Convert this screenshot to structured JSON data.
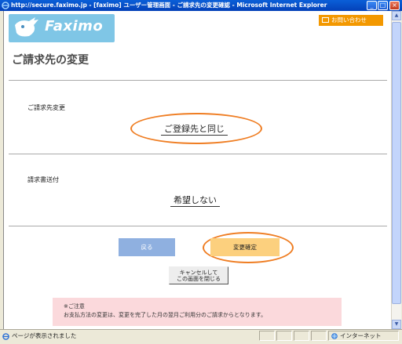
{
  "window": {
    "title": "http://secure.faximo.jp - [faximo] ユーザー管理画面 - ご請求先の変更確認 - Microsoft Internet Explorer",
    "minimize": "_",
    "maximize": "□",
    "close": "×"
  },
  "header": {
    "logo_text": "Faximo",
    "contact_label": "お問い合わせ",
    "contact_color": "#f39800"
  },
  "page": {
    "title": "ご請求先の変更"
  },
  "billing": {
    "label": "ご請求先変更",
    "value": "ご登録先と同じ"
  },
  "invoice": {
    "label": "請求書送付",
    "value": "希望しない"
  },
  "buttons": {
    "back": "戻る",
    "confirm": "変更確定",
    "cancel_line1": "キャンセルして",
    "cancel_line2": "この画面を閉じる"
  },
  "notice": {
    "heading": "※ご注意",
    "text": "お支払方法の変更は、変更を完了した月の翌月ご利用分のご請求からとなります。"
  },
  "status": {
    "text": "ページが表示されました",
    "zone": "インターネット"
  },
  "colors": {
    "highlight_oval": "#ef7d22",
    "back_button": "#8fb0e0",
    "confirm_button": "#fcd07e",
    "notice_bg": "#fbd9dc"
  }
}
